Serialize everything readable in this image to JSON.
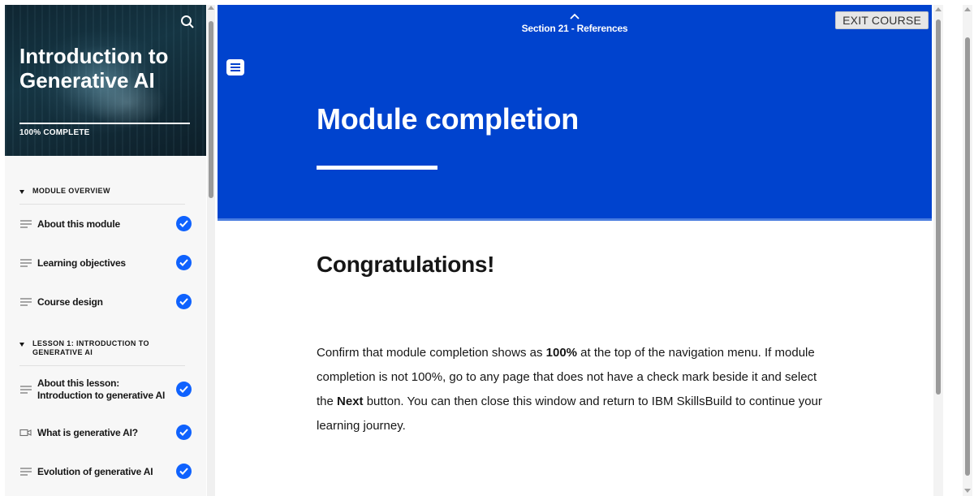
{
  "sidebar": {
    "course_title": "Introduction to Generative AI",
    "progress_label": "100% COMPLETE",
    "progress_fraction": 1.0,
    "search_icon": "search-icon",
    "sections": [
      {
        "title": "MODULE OVERVIEW",
        "items": [
          {
            "label": "About this module",
            "icon": "text-lines-icon",
            "completed": true
          },
          {
            "label": "Learning objectives",
            "icon": "text-lines-icon",
            "completed": true
          },
          {
            "label": "Course design",
            "icon": "text-lines-icon",
            "completed": true
          }
        ]
      },
      {
        "title": "LESSON 1: INTRODUCTION TO GENERATIVE AI",
        "items": [
          {
            "label": "About this lesson: Introduction to generative AI",
            "icon": "text-lines-icon",
            "completed": true
          },
          {
            "label": "What is generative AI?",
            "icon": "video-icon",
            "completed": true
          },
          {
            "label": "Evolution of generative AI",
            "icon": "text-lines-icon",
            "completed": true
          }
        ]
      }
    ]
  },
  "header": {
    "section_title": "Section 21 - References",
    "exit_label": "EXIT COURSE",
    "page_title": "Module completion"
  },
  "main": {
    "heading": "Congratulations!",
    "body_part1": "Confirm that module completion shows as ",
    "body_bold1": "100%",
    "body_part2": " at the top of the navigation menu. If module completion is not 100%, go to any page that does not have a check mark beside it and select the ",
    "body_bold2": "Next",
    "body_part3": " button. You can then close this window and return to IBM SkillsBuild to continue your learning journey."
  },
  "colors": {
    "banner": "#0043ce",
    "check": "#0f62fe",
    "sidebar_bg": "#f7f7f7"
  }
}
